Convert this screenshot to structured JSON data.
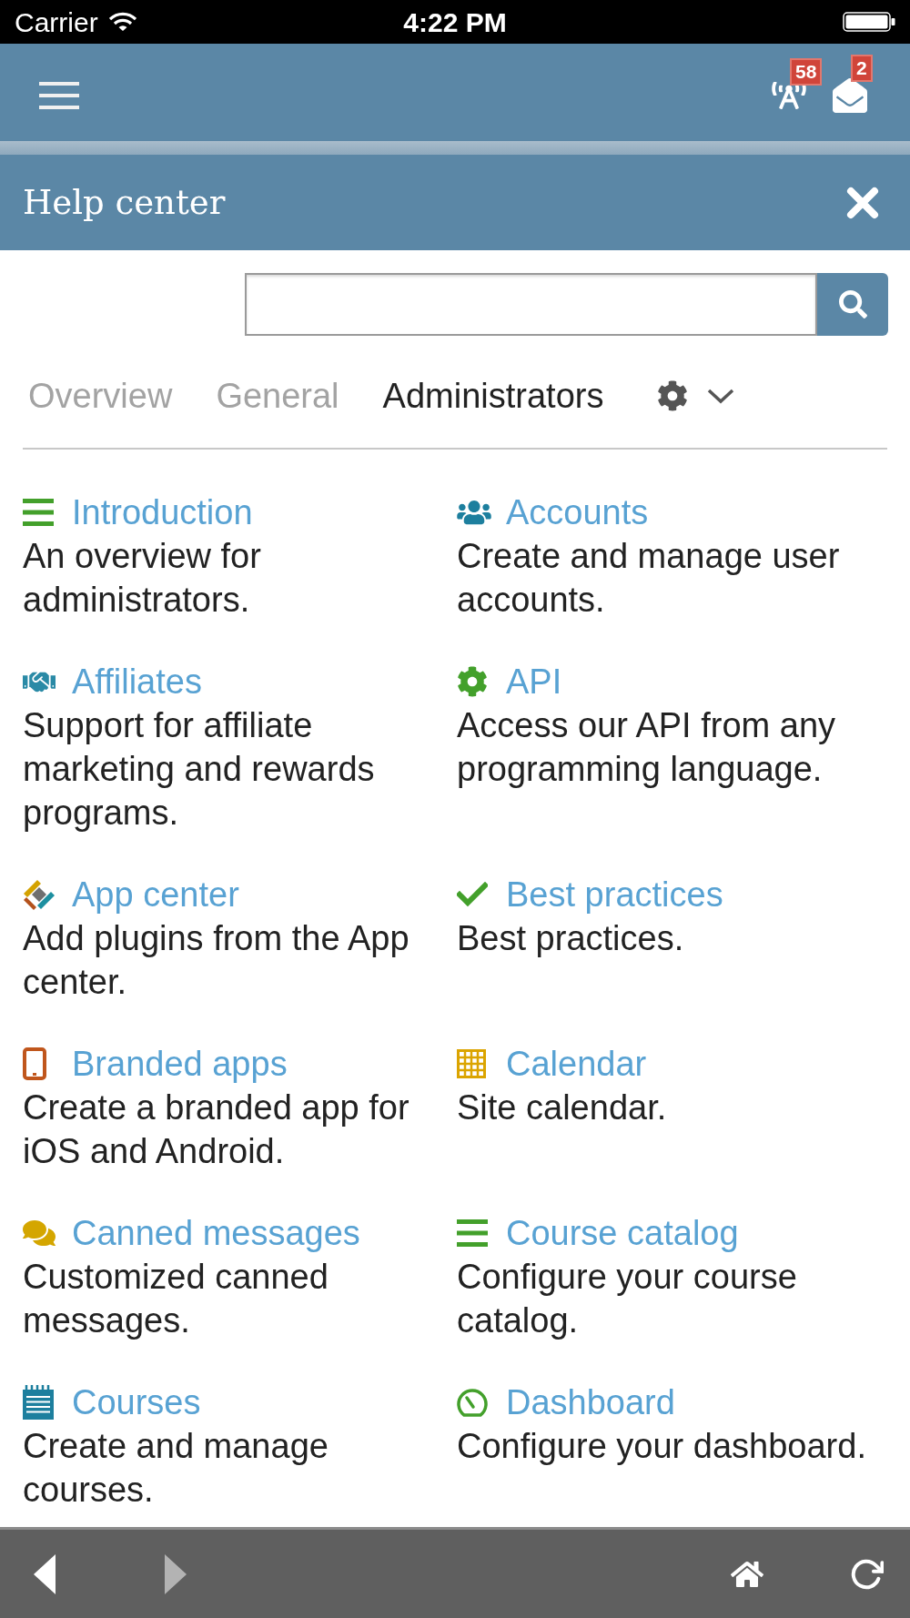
{
  "status_bar": {
    "carrier": "Carrier",
    "time": "4:22 PM"
  },
  "top_bar": {
    "notifications": [
      {
        "kind": "signal",
        "count": "58"
      },
      {
        "kind": "mail",
        "count": "2"
      }
    ]
  },
  "panel": {
    "title": "Help center"
  },
  "tabs": [
    {
      "label": "Overview",
      "selected": false
    },
    {
      "label": "General",
      "selected": false
    },
    {
      "label": "Administrators",
      "selected": true
    }
  ],
  "topics": [
    {
      "kind": "list",
      "color": "#43a02b",
      "title": "Introduction",
      "description": "An overview for administrators."
    },
    {
      "kind": "users",
      "color": "#1d7f9e",
      "title": "Accounts",
      "description": "Create and manage user accounts."
    },
    {
      "kind": "handshake",
      "color": "#2a8aa6",
      "title": "Affiliates",
      "description": "Support for affiliate marketing and rewards programs."
    },
    {
      "kind": "gear",
      "color": "#43a02b",
      "title": "API",
      "description": "Access our API from any programming language."
    },
    {
      "kind": "apps",
      "title": "App center",
      "description": "Add plugins from the App center."
    },
    {
      "kind": "check",
      "color": "#43a02b",
      "title": "Best practices",
      "description": "Best practices."
    },
    {
      "kind": "tablet",
      "color": "#c0561c",
      "title": "Branded apps",
      "description": "Create a branded app for iOS and Android."
    },
    {
      "kind": "calendar",
      "color": "#dba400",
      "title": "Calendar",
      "description": "Site calendar."
    },
    {
      "kind": "chat",
      "color": "#d4a600",
      "title": "Canned messages",
      "description": "Customized canned messages."
    },
    {
      "kind": "list",
      "color": "#43a02b",
      "title": "Course catalog",
      "description": "Configure your course catalog."
    },
    {
      "kind": "notepad",
      "color": "#1d7f9e",
      "title": "Courses",
      "description": "Create and manage courses."
    },
    {
      "kind": "gauge",
      "color": "#43a02b",
      "title": "Dashboard",
      "description": "Configure your dashboard."
    }
  ],
  "toolbar": [
    {
      "kind": "back",
      "disabled": false
    },
    {
      "kind": "forward",
      "disabled": true
    },
    {
      "kind": "home",
      "disabled": false
    },
    {
      "kind": "reload",
      "disabled": false
    }
  ]
}
